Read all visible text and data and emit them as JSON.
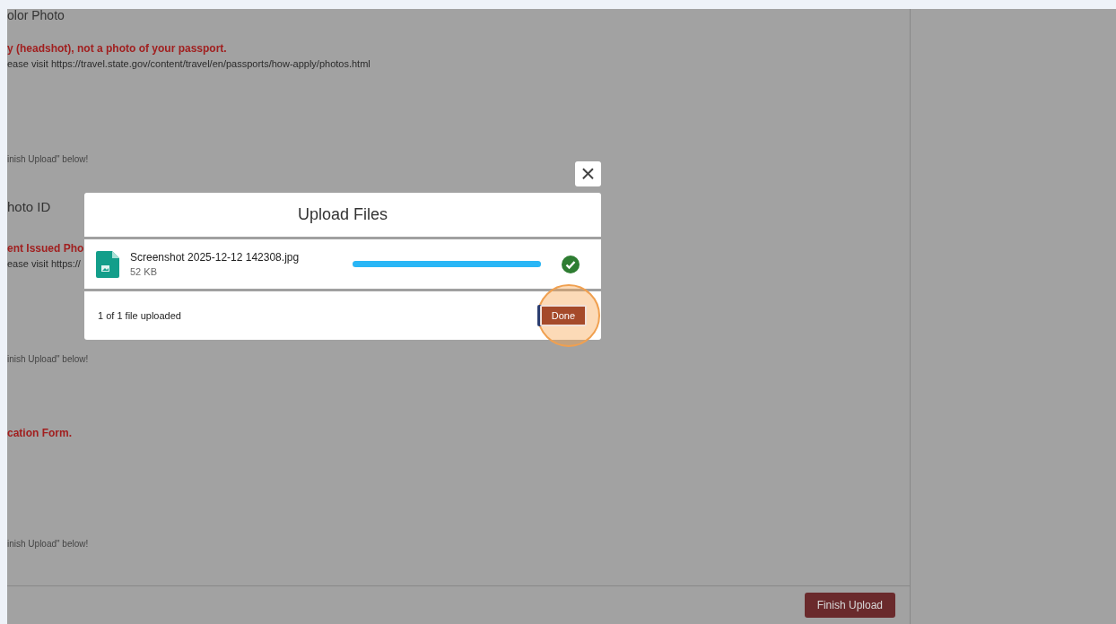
{
  "page": {
    "heading_partial": "olor Photo",
    "sections": [
      {
        "warning": "y (headshot), not a photo of your passport.",
        "info": "ease visit https://travel.state.gov/content/travel/en/passports/how-apply/photos.html",
        "hint": "inish Upload\" below!"
      },
      {
        "title": "hoto ID",
        "warning": "ent Issued Pho",
        "info": "ease visit https://",
        "hint": "inish Upload\" below!"
      },
      {
        "warning": "cation Form.",
        "hint": "inish Upload\" below!"
      }
    ],
    "finish_button": "Finish Upload"
  },
  "dialog": {
    "title": "Upload Files",
    "close": "×",
    "files": [
      {
        "name": "Screenshot 2025-12-12 142308.jpg",
        "size": "52 KB",
        "level": 1,
        "complete": true
      }
    ],
    "status": "1 of 1 file uploaded",
    "done_button": "Done",
    "done_highlighted": true
  }
}
